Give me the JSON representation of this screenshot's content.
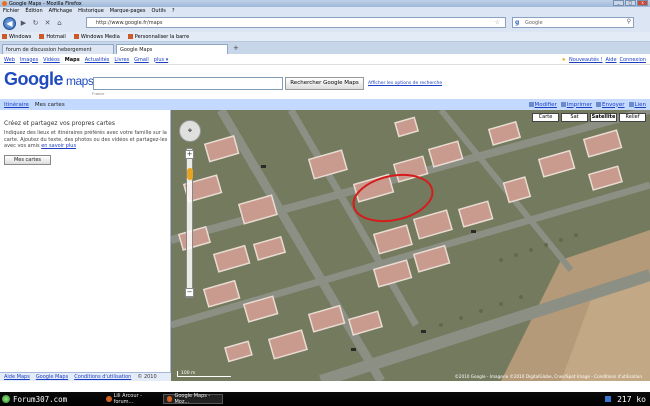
{
  "window": {
    "title": "Google Maps - Mozilla Firefox",
    "min": "_",
    "max": "□",
    "close": "x"
  },
  "menu": [
    "Fichier",
    "Édition",
    "Affichage",
    "Historique",
    "Marque-pages",
    "Outils",
    "?"
  ],
  "nav": {
    "back": "◀",
    "forward": "▶",
    "reload": "↻",
    "stop": "✕",
    "home": "⌂",
    "url": "http://www.google.fr/maps",
    "url_star": "☆",
    "search_placeholder": "Google",
    "search_engine": "g",
    "search_icon": "⚲"
  },
  "bookmarks": [
    "Windows",
    "Hotmail",
    "Windows Media",
    "Personnaliser la barre"
  ],
  "tabs": [
    {
      "label": "forum de discussion hebergement"
    },
    {
      "label": "Google Maps"
    }
  ],
  "tab_new": "+",
  "gbar": {
    "items": [
      "Web",
      "Images",
      "Vidéos",
      "Maps",
      "Actualités",
      "Livres",
      "Gmail",
      "plus ▾"
    ],
    "right": [
      "★",
      "Nouveautés !",
      "Aide",
      "Connexion"
    ]
  },
  "logo": {
    "g": "Google",
    "maps": "maps",
    "beta": "France"
  },
  "search": {
    "button": "Rechercher Google Maps",
    "options": "Afficher les options de recherche"
  },
  "bluebar": {
    "left": [
      "Itinéraire",
      "Mes cartes"
    ],
    "right": [
      "Modifier",
      "Imprimer",
      "Envoyer",
      "Lien"
    ]
  },
  "sidebar": {
    "heading": "Créez et partagez vos propres cartes",
    "text": "Indiquez des lieux et itinéraires préférés avec votre famille sur la carte. Ajoutez du texte, des photos ou des vidéos et partagez-les avec vos amis",
    "link": "en savoir plus",
    "button": "Mes cartes",
    "footer": [
      "Aide Maps",
      "Google Maps",
      "Conditions d'utilisation",
      "© 2010"
    ]
  },
  "map": {
    "types": [
      "Carte",
      "Sat",
      "Satellite",
      "Relief"
    ],
    "active_type": "Satellite",
    "scale": "100 m",
    "copyright": "©2010 Google - Imagerie ©2010 DigitalGlobe, Cnes/Spot Image - Conditions d'utilisation",
    "zoom_in": "+",
    "zoom_out": "−"
  },
  "taskbar": {
    "forum": "Forum307.com",
    "tasks": [
      "Lili Arcour - forum...",
      "Google Maps - Moz..."
    ],
    "size": "217 ko"
  }
}
